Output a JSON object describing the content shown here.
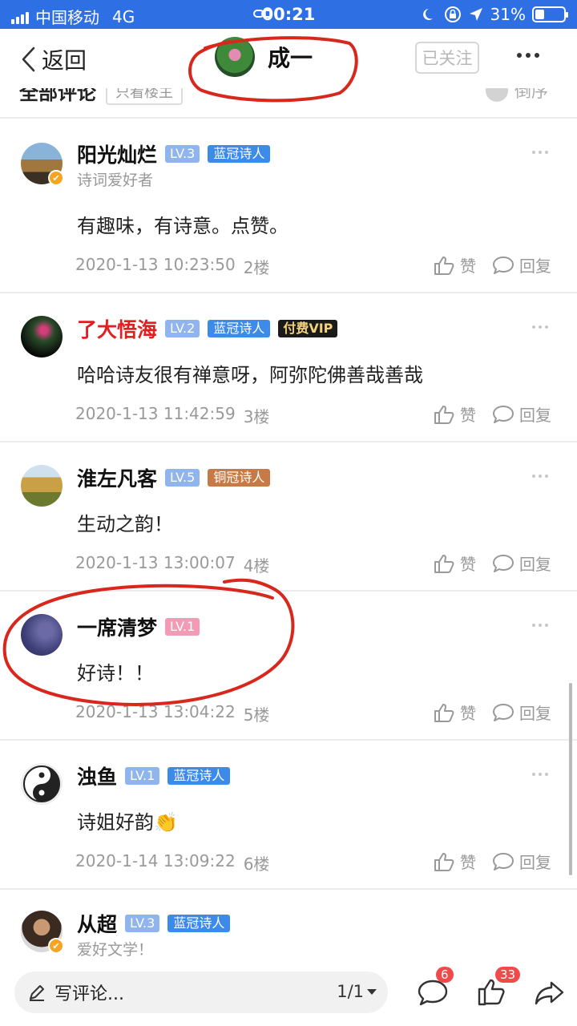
{
  "status_bar": {
    "carrier": "中国移动",
    "network": "4G",
    "time": "00:21",
    "battery": "31%"
  },
  "nav": {
    "back_label": "返回",
    "title": "成一",
    "follow_label": "已关注"
  },
  "section_header": {
    "title": "全部评论",
    "only_op_label": "只看楼主",
    "order_label": "倒序"
  },
  "comments": [
    {
      "name": "阳光灿烂",
      "level": "LV.3",
      "badge": "蓝冠诗人",
      "subtitle": "诗词爱好者",
      "text": "有趣味，有诗意。点赞。",
      "time": "2020-1-13 10:23:50",
      "floor": "2楼",
      "like_label": "赞",
      "reply_label": "回复"
    },
    {
      "name": "了大悟海",
      "level": "LV.2",
      "badge": "蓝冠诗人",
      "vip": "付费VIP",
      "text": "哈哈诗友很有禅意呀，阿弥陀佛善哉善哉",
      "time": "2020-1-13 11:42:59",
      "floor": "3楼",
      "like_label": "赞",
      "reply_label": "回复"
    },
    {
      "name": "淮左凡客",
      "level": "LV.5",
      "badge": "铜冠诗人",
      "text": "生动之韵！",
      "time": "2020-1-13 13:00:07",
      "floor": "4楼",
      "like_label": "赞",
      "reply_label": "回复"
    },
    {
      "name": "一席清梦",
      "level": "LV.1",
      "text": "好诗！！",
      "time": "2020-1-13 13:04:22",
      "floor": "5楼",
      "like_label": "赞",
      "reply_label": "回复"
    },
    {
      "name": "浊鱼",
      "level": "LV.1",
      "badge": "蓝冠诗人",
      "text": "诗姐好韵👏",
      "time": "2020-1-14 13:09:22",
      "floor": "6楼",
      "like_label": "赞",
      "reply_label": "回复"
    },
    {
      "name": "从超",
      "level": "LV.3",
      "badge": "蓝冠诗人",
      "subtitle": "爱好文学！"
    }
  ],
  "bottom_bar": {
    "placeholder": "写评论...",
    "page": "1/1",
    "comment_count": "6",
    "like_count": "33"
  },
  "colors": {
    "status_blue": "#2f6fe4",
    "tag_blue": "#3d8be8",
    "level_blue": "#8fb4ee",
    "level_pink": "#f39ab4",
    "tag_bronze": "#c77a45",
    "red_name": "#e02020",
    "badge_red": "#f04a4a"
  },
  "icons": {
    "signal": "signal-bars-icon",
    "link": "link-icon",
    "moon": "moon-icon",
    "lock": "rotation-lock-icon",
    "location": "location-arrow-icon",
    "battery": "battery-icon",
    "back": "chevron-left-icon",
    "more": "more-dots-icon",
    "like": "thumbs-up-icon",
    "reply": "speech-bubble-icon",
    "pen": "pen-icon",
    "share": "share-arrow-icon"
  }
}
